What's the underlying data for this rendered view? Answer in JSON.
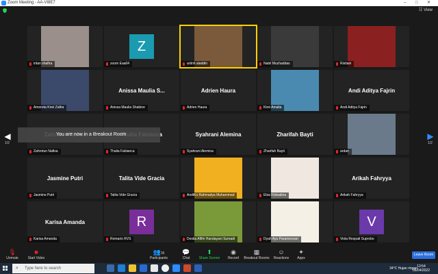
{
  "window": {
    "title": "Zoom Meeting - AA-VI8E7",
    "controls": [
      "–",
      "□",
      "✕"
    ]
  },
  "topbar": {
    "view_label": "View"
  },
  "nav": {
    "page_left": "1/2",
    "page_right": "1/2"
  },
  "breakout_notice": "You are now in a Breakout Room",
  "tiles": [
    {
      "type": "video",
      "name": "intan shafira",
      "bg": "#9a8f8a"
    },
    {
      "type": "avatar",
      "letter": "Z",
      "color": "#1a9bb0",
      "name": "zoom Eaa04"
    },
    {
      "type": "video",
      "name": "artinh aladdin",
      "bg": "#7a5a3a",
      "highlight": true
    },
    {
      "type": "video",
      "name": "Nabil Muchaddas",
      "bg": "#3a3a3a"
    },
    {
      "type": "video",
      "name": "Ristiani",
      "bg": "#8a2020"
    },
    {
      "type": "video",
      "name": "Amoreta Kirei Zafira",
      "bg": "#3b4a6a"
    },
    {
      "type": "text",
      "big": "Anissa  Maulia  S...",
      "name": "Anissa Maulia Shabine"
    },
    {
      "type": "text",
      "big": "Adrien Haura",
      "name": "Adrien Haura"
    },
    {
      "type": "video",
      "name": "Kirei Amalia",
      "bg": "#4a8ab0"
    },
    {
      "type": "text",
      "big": "Andi Aditya Fajrin",
      "name": "Andi Aditya Fajrin"
    },
    {
      "type": "text",
      "big": "Zahrotun Nafisa",
      "name": "Zahrotun Nafisa"
    },
    {
      "type": "text",
      "big": "Thalia Fabianca",
      "name": "Thalia Fabianca"
    },
    {
      "type": "text",
      "big": "Syahrani Alemina",
      "name": "Syahrani Alemina"
    },
    {
      "type": "text",
      "big": "Zharifah Bayti",
      "name": "Zharifah Bayti"
    },
    {
      "type": "video",
      "name": "ardan",
      "bg": "#6a7a8a"
    },
    {
      "type": "text",
      "big": "Jasmine Putri",
      "name": "Jasmine Putri"
    },
    {
      "type": "text",
      "big": "Talita Vide Gracia",
      "name": "Talita Vide Gracia"
    },
    {
      "type": "video",
      "name": "AndiKo Rahmadya Muhammad",
      "bg": "#f0b020"
    },
    {
      "type": "video",
      "name": "Elsa Roksalina",
      "bg": "#f0e8e0"
    },
    {
      "type": "text",
      "big": "Arikah Fahryya",
      "name": "Arikah Fahryya"
    },
    {
      "type": "text",
      "big": "Karisa Amanda",
      "name": "Karisa Amanda"
    },
    {
      "type": "avatar",
      "letter": "R",
      "color": "#7a2e9a",
      "name": "Romario RVS"
    },
    {
      "type": "video",
      "name": "Destia Afifin Handayani Sumadi",
      "bg": "#7a9a3a"
    },
    {
      "type": "video",
      "name": "Dyah Ayu Paramesvari",
      "bg": "#f4f0e6"
    },
    {
      "type": "avatar",
      "letter": "V",
      "color": "#6a3aaa",
      "name": "Viola Respati Suprobo"
    }
  ],
  "toolbar": {
    "unmute": "Unmute",
    "start_video": "Start Video",
    "participants": "Participants",
    "participants_count": "36",
    "chat": "Chat",
    "share_screen": "Share Screen",
    "record": "Record",
    "breakout_rooms": "Breakout Rooms",
    "reactions": "Reactions",
    "apps": "Apps",
    "leave": "Leave Room"
  },
  "taskbar": {
    "search_placeholder": "Type here to search",
    "weather": "34°C  Hujan ringan",
    "time": "13:54",
    "date": "06/04/2022"
  },
  "colors": {
    "accent": "#2d8cff",
    "green": "#23d959",
    "highlight": "#ffd200"
  }
}
